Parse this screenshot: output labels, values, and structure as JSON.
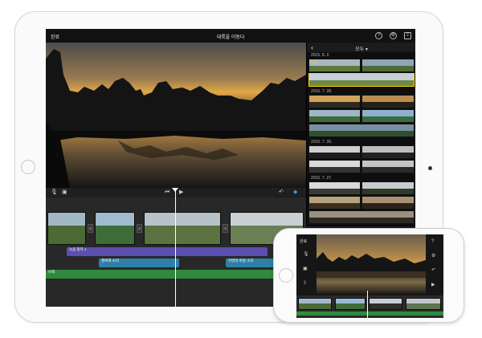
{
  "ipad": {
    "topbar": {
      "done_label": "완료",
      "title": "대륙을 이동다",
      "help_glyph": "?",
      "settings_glyph": "⚙",
      "share_glyph": "⇪"
    },
    "browser": {
      "back_glyph": "‹",
      "filter_label": "모두 ▾",
      "dates": [
        "2015. 8. 2.",
        "2015. 7. 28.",
        "2015. 7. 26.",
        "2015. 7. 27."
      ],
      "thumb_labels": [
        "5:58"
      ]
    },
    "controls": {
      "mic_glyph": "🎙",
      "camera_glyph": "▣",
      "rewind_glyph": "⏮",
      "play_glyph": "▶",
      "undo_glyph": "↶",
      "audio_glyph": "◆"
    },
    "timeline": {
      "transition_glyph": "⧖",
      "tracks": [
        {
          "label": "녹음 항목 1",
          "color": "#5b4fb0"
        },
        {
          "label": "행복해 소리",
          "color": "#2f7fa8"
        },
        {
          "label": "자연의 바람 소리",
          "color": "#2f7fa8"
        },
        {
          "label": "브레",
          "color": "#2e8b3e"
        }
      ]
    }
  },
  "iphone": {
    "done_label": "완료",
    "help_glyph": "?",
    "settings_glyph": "⚙",
    "undo_glyph": "↶",
    "play_glyph": "▶",
    "mic_glyph": "🎙",
    "camera_glyph": "▣",
    "share_glyph": "⇪"
  },
  "colors": {
    "accent_yellow": "#ffd400",
    "audio_purple": "#5b4fb0",
    "audio_blue": "#2f7fa8",
    "music_green": "#2e8b3e"
  }
}
